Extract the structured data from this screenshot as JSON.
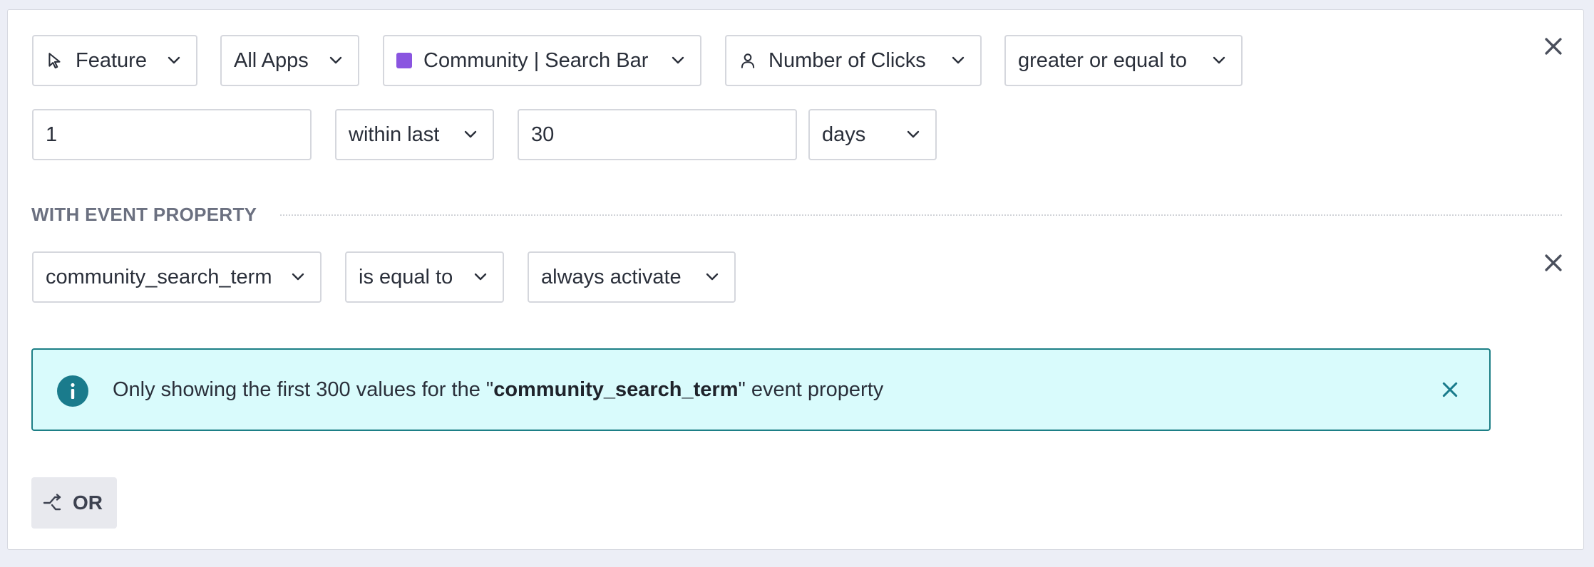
{
  "row1": {
    "feature_type": {
      "label": "Feature",
      "icon": "cursor-pointer-icon"
    },
    "app_scope": {
      "label": "All Apps"
    },
    "feature_name": {
      "label": "Community | Search Bar",
      "swatch_color": "#8a55e0"
    },
    "metric": {
      "label": "Number of Clicks",
      "icon": "user-icon"
    },
    "comparator": {
      "label": "greater or equal to"
    }
  },
  "row2": {
    "count_value": "1",
    "time_mode": {
      "label": "within last"
    },
    "time_amount": "30",
    "time_unit": {
      "label": "days"
    }
  },
  "event_property": {
    "section_title": "WITH EVENT PROPERTY",
    "property": {
      "label": "community_search_term"
    },
    "operator": {
      "label": "is equal to"
    },
    "value": {
      "label": "always activate"
    }
  },
  "banner": {
    "icon": "info-circle-icon",
    "prefix": "Only showing the first 300 values for the \"",
    "property_name": "community_search_term",
    "suffix": "\" event property",
    "background_color": "#d9fbfc",
    "border_color": "#1d7f86"
  },
  "or_button": {
    "label": "OR",
    "icon": "branch-split-icon"
  }
}
